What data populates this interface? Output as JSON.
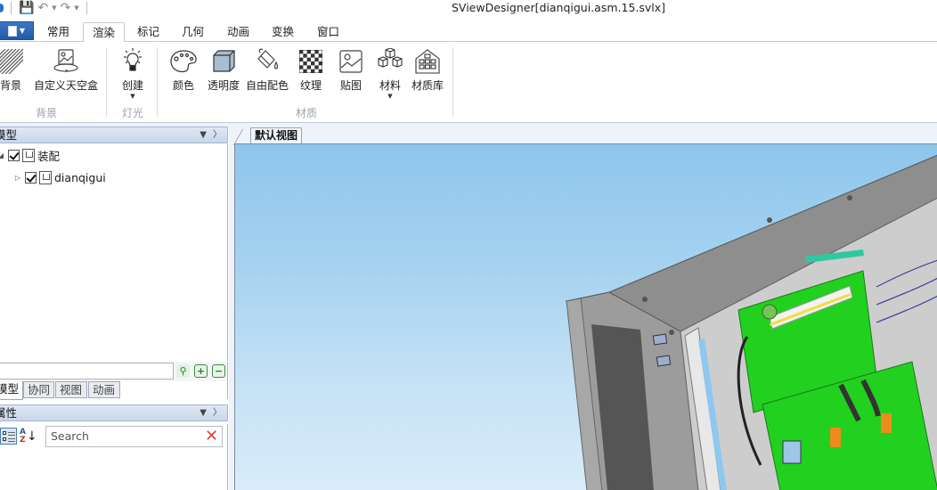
{
  "window": {
    "title": "SViewDesigner[dianqigui.asm.15.svlx]"
  },
  "quick_access": {
    "icons": [
      "save-icon",
      "undo-icon",
      "redo-icon"
    ]
  },
  "ribbon_tabs": [
    {
      "label": "常用",
      "active": false
    },
    {
      "label": "渲染",
      "active": true
    },
    {
      "label": "标记",
      "active": false
    },
    {
      "label": "几何",
      "active": false
    },
    {
      "label": "动画",
      "active": false
    },
    {
      "label": "变换",
      "active": false
    },
    {
      "label": "窗口",
      "active": false
    }
  ],
  "ribbon": {
    "groups": [
      {
        "label": "背景",
        "buttons": [
          {
            "label": "背景",
            "icon": "background-hatch-icon"
          },
          {
            "label": "自定义天空盒",
            "icon": "skybox-icon"
          }
        ]
      },
      {
        "label": "灯光",
        "buttons": [
          {
            "label": "创建",
            "icon": "lightbulb-icon",
            "dropdown": true
          }
        ]
      },
      {
        "label": "材质",
        "buttons": [
          {
            "label": "颜色",
            "icon": "palette-icon"
          },
          {
            "label": "透明度",
            "icon": "transparency-cube-icon"
          },
          {
            "label": "自由配色",
            "icon": "paint-bucket-icon"
          },
          {
            "label": "纹理",
            "icon": "checker-texture-icon"
          },
          {
            "label": "贴图",
            "icon": "image-map-icon"
          },
          {
            "label": "材料",
            "icon": "material-cubes-icon",
            "dropdown": true
          },
          {
            "label": "材质库",
            "icon": "material-library-icon"
          }
        ]
      }
    ]
  },
  "model_panel": {
    "title": "模型",
    "tree": [
      {
        "label": "装配",
        "checked": true,
        "expanded": true,
        "level": 0
      },
      {
        "label": "dianqigui",
        "checked": true,
        "expanded": false,
        "level": 1
      }
    ],
    "filter_value": "",
    "tabs": [
      {
        "label": "模型",
        "active": true
      },
      {
        "label": "协同",
        "active": false
      },
      {
        "label": "视图",
        "active": false
      },
      {
        "label": "动画",
        "active": false
      }
    ]
  },
  "properties_panel": {
    "title": "属性",
    "search_placeholder": "Search"
  },
  "main_view": {
    "tab_label": "默认视图"
  }
}
